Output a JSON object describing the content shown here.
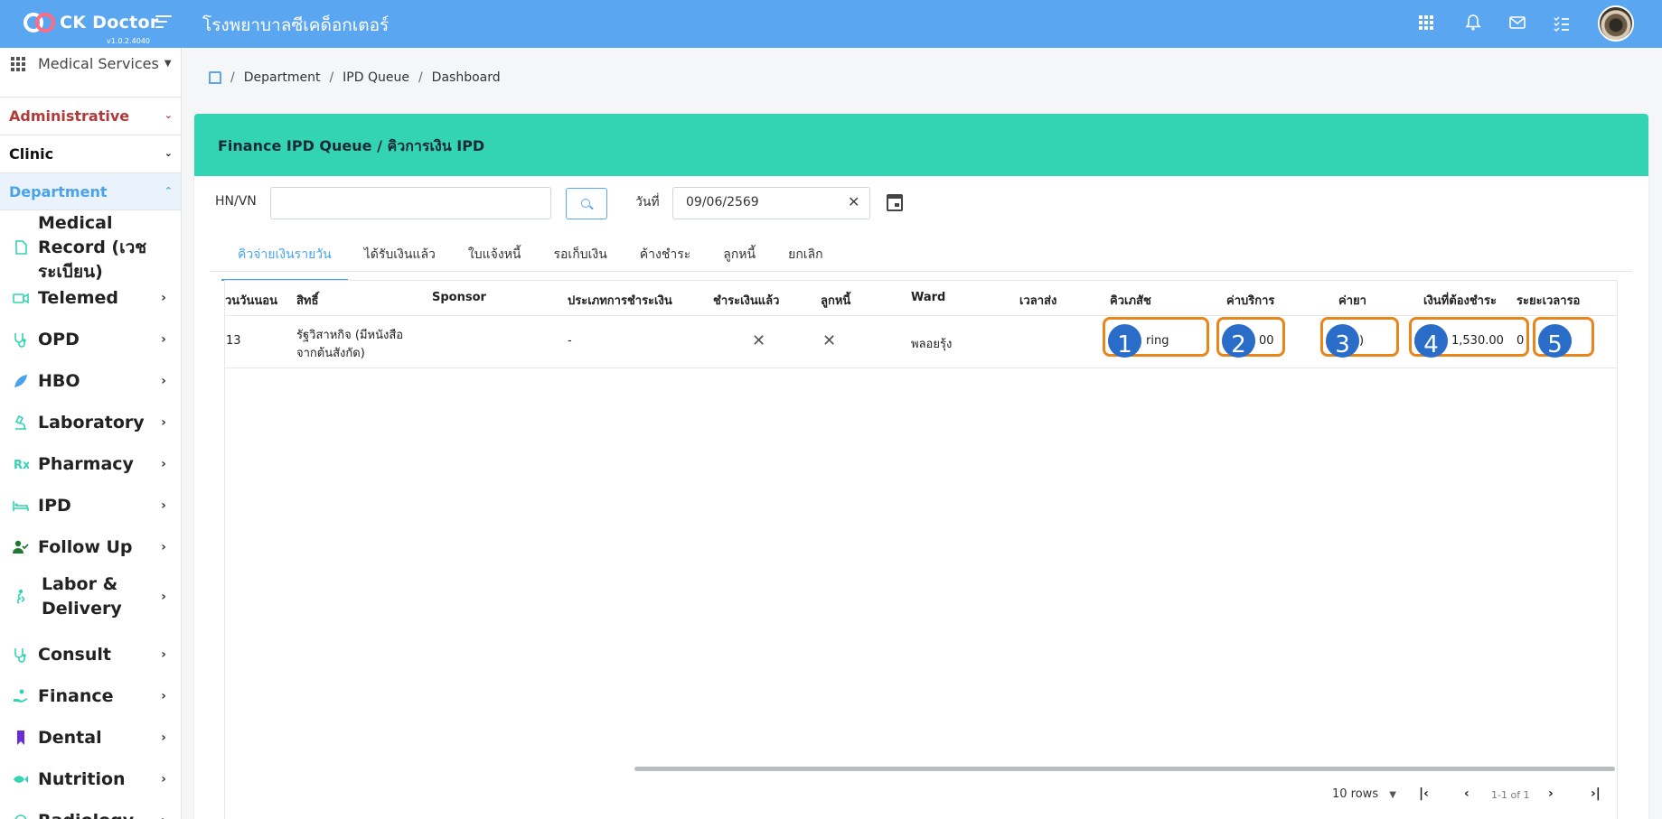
{
  "app": {
    "brand": "CK Doctor",
    "version": "v1.0.2.4040",
    "hospital": "โรงพยาบาลซีเคด็อกเตอร์"
  },
  "header_icons": [
    "apps-icon",
    "bell-icon",
    "mail-icon",
    "checklist-icon",
    "user-avatar"
  ],
  "sidebar": {
    "services_label": "Medical Services",
    "groups": {
      "administrative": "Administrative",
      "clinic": "Clinic",
      "department": "Department"
    },
    "items": [
      {
        "label": "Medical Record (เวชระเบียน)",
        "icon": "document-icon",
        "color": "#33d4b3"
      },
      {
        "label": "Telemed",
        "icon": "video-icon",
        "color": "#33d4b3"
      },
      {
        "label": "OPD",
        "icon": "stethoscope-icon",
        "color": "#33d4b3"
      },
      {
        "label": "HBO",
        "icon": "leaf-icon",
        "color": "#4aa3ea"
      },
      {
        "label": "Laboratory",
        "icon": "microscope-icon",
        "color": "#33d4b3"
      },
      {
        "label": "Pharmacy",
        "icon": "rx-icon",
        "color": "#33d4b3"
      },
      {
        "label": "IPD",
        "icon": "bed-icon",
        "color": "#33d4b3"
      },
      {
        "label": "Follow Up",
        "icon": "user-check-icon",
        "color": "#1f7a2e"
      },
      {
        "label": "Labor & Delivery",
        "icon": "mother-icon",
        "color": "#33d4b3"
      },
      {
        "label": "Consult",
        "icon": "stethoscope-icon",
        "color": "#33d4b3"
      },
      {
        "label": "Finance",
        "icon": "hand-coin-icon",
        "color": "#33d4b3"
      },
      {
        "label": "Dental",
        "icon": "bookmark-icon",
        "color": "#6a2bd9"
      },
      {
        "label": "Nutrition",
        "icon": "fish-icon",
        "color": "#33d4b3"
      },
      {
        "label": "Radiology",
        "icon": "radiology-icon",
        "color": "#33d4b3"
      }
    ]
  },
  "breadcrumb": [
    "Department",
    "IPD Queue",
    "Dashboard"
  ],
  "card": {
    "title": "Finance IPD Queue / คิวการเงิน IPD"
  },
  "filters": {
    "hn_label": "HN/VN",
    "hn_value": "",
    "date_label": "วันที่",
    "date_value": "09/06/2569"
  },
  "tabs": [
    "คิวจ่ายเงินรายวัน",
    "ได้รับเงินแล้ว",
    "ใบแจ้งหนี้",
    "รอเก็บเงิน",
    "ค้างชำระ",
    "ลูกหนี้",
    "ยกเลิก"
  ],
  "table": {
    "columns": [
      "วนวันนอน",
      "สิทธิ์",
      "Sponsor",
      "ประเภทการชำระเงิน",
      "ชำระเงินแล้ว",
      "ลูกหนี้",
      "Ward",
      "เวลาส่ง",
      "คิวเภสัช",
      "ค่าบริการ",
      "ค่ายา",
      "เงินที่ต้องชำระ",
      "ระยะเวลารอ"
    ],
    "rows": [
      {
        "days": "13",
        "right_line1": "รัฐวิสาหกิจ (มีหนังสือ",
        "right_line2": "จากต้นสังกัด)",
        "sponsor": "",
        "payment_type": "-",
        "paid": "✕",
        "debtor": "✕",
        "ward": "พลอยรุ้ง",
        "sent_time": "",
        "pharmacy_queue": "ring",
        "service_fee": "00",
        "drug_fee": ")",
        "amount_due": "1,530.00",
        "wait_time": "0"
      }
    ]
  },
  "annotations": [
    "1",
    "2",
    "3",
    "4",
    "5"
  ],
  "pagination": {
    "rows_per_page": "10 rows",
    "range": "1-1 of 1"
  },
  "colors": {
    "topbar": "#5aa6f1",
    "card_header": "#33d4b3",
    "highlight": "#e8861c",
    "badge": "#2a6dc9",
    "active_tab": "#4aa3ea"
  }
}
